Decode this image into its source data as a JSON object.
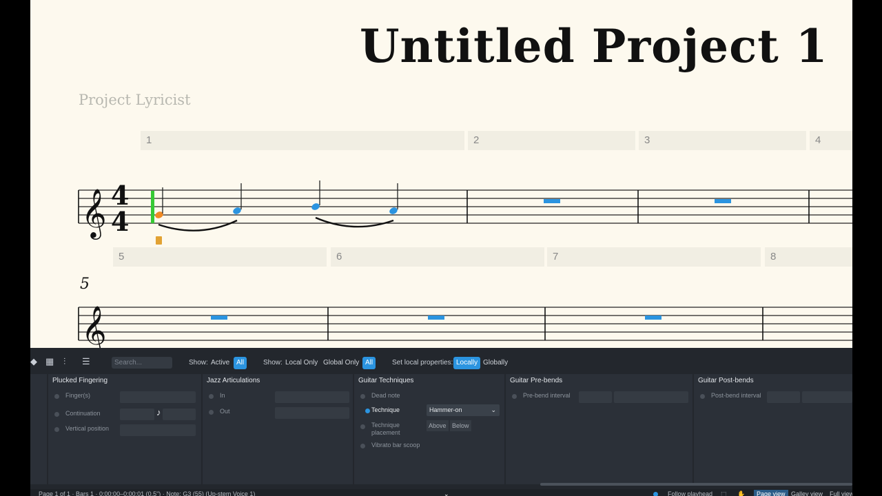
{
  "score": {
    "title": "Untitled Project 1",
    "lyricist": "Project Lyricist",
    "bar_numbers": [
      "1",
      "2",
      "3",
      "4",
      "5",
      "6",
      "7",
      "8"
    ],
    "system_number": "5",
    "time_signature": "4/4"
  },
  "toolbar": {
    "search_placeholder": "Search...",
    "show_label_1": "Show:",
    "active": "Active",
    "all_1": "All",
    "show_label_2": "Show:",
    "local_only": "Local Only",
    "global_only": "Global Only",
    "all_2": "All",
    "set_local_label": "Set local properties:",
    "locally": "Locally",
    "globally": "Globally"
  },
  "groups": {
    "plucked": {
      "title": "Plucked Fingering",
      "fingers": "Finger(s)",
      "continuation": "Continuation",
      "vertical": "Vertical position",
      "note_glyph": "♪"
    },
    "jazz": {
      "title": "Jazz Articulations",
      "in": "In",
      "out": "Out"
    },
    "guitar_tech": {
      "title": "Guitar Techniques",
      "dead_note": "Dead note",
      "technique": "Technique",
      "technique_value": "Hammer-on",
      "technique_placement": "Technique placement",
      "above": "Above",
      "below": "Below",
      "vibrato": "Vibrato bar scoop"
    },
    "prebends": {
      "title": "Guitar Pre-bends",
      "interval": "Pre-bend interval"
    },
    "postbends": {
      "title": "Guitar Post-bends",
      "interval": "Post-bend interval"
    }
  },
  "status": {
    "info": "Page 1 of 1 · Bars 1 · 0:00:00–0:00:01 (0.5\") · Note: G3 (55) (Up-stem Voice 1)",
    "follow": "Follow playhead",
    "page_view": "Page view",
    "galley_view": "Galley view",
    "full_view": "Full view"
  },
  "colors": {
    "accent": "#2b94e0",
    "selection_green": "#36c934",
    "selection_orange": "#f08a24",
    "note_blue": "#2b94e0",
    "paper": "#fdf9ee"
  },
  "icons": [
    "note-tool-icon",
    "grid-icon",
    "mixer-icon",
    "list-icon",
    "chevron-down-icon",
    "select-box-icon",
    "hand-icon"
  ]
}
